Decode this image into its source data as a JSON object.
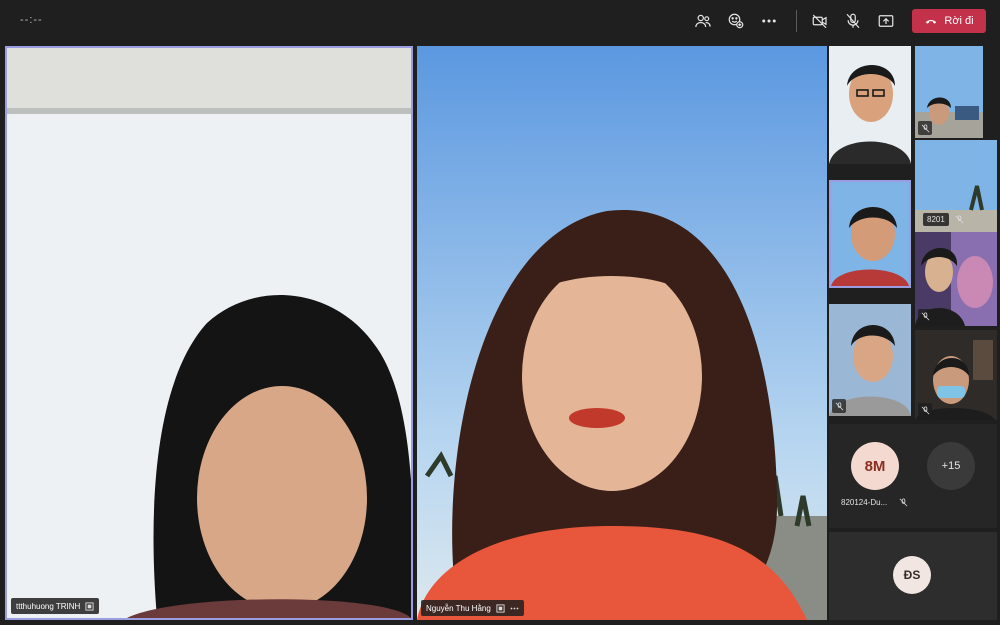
{
  "topbar": {
    "timer": "--:--",
    "icons": [
      "participants-icon",
      "reactions-icon",
      "more-icon",
      "camera-off-icon",
      "mic-off-icon",
      "share-icon"
    ],
    "leave_label": "Rời đi"
  },
  "main_tiles": [
    {
      "name": "ttthuhuong TRINH"
    },
    {
      "name": "Nguyễn Thu Hằng"
    }
  ],
  "thumbnails": {
    "tag_8201": "8201",
    "avatar_initials": "8M",
    "avatar_name": "820124-Du...",
    "overflow_count": "+15",
    "ds_initials": "ĐS"
  },
  "colors": {
    "leave_button": "#c4314b",
    "active_border": "#9a9ee0",
    "avatar_bg": "#f3d9d0",
    "avatar_text": "#8a2e22"
  }
}
